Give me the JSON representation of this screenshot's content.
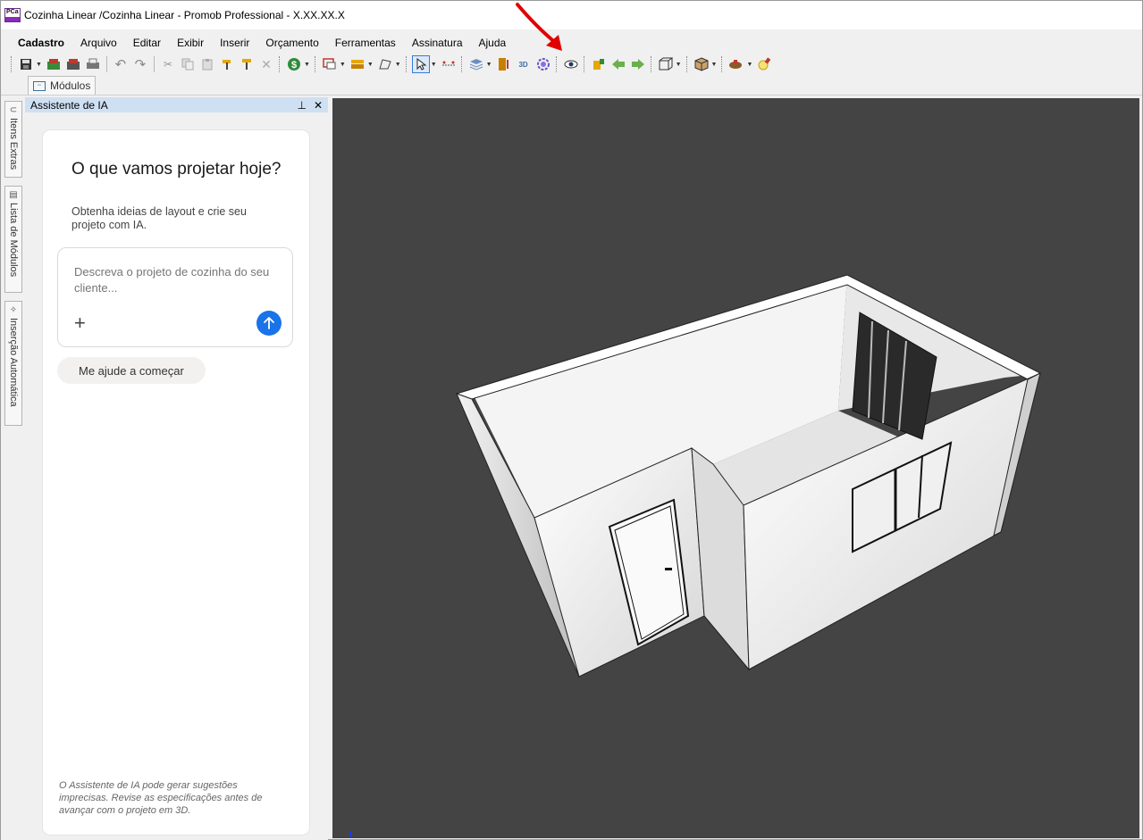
{
  "window": {
    "title": "Cozinha Linear /Cozinha Linear - Promob  Professional -  X.XX.XX.X",
    "logo_text": "PCa"
  },
  "menu": {
    "items": [
      "Cadastro",
      "Arquivo",
      "Editar",
      "Exibir",
      "Inserir",
      "Orçamento",
      "Ferramentas",
      "Assinatura",
      "Ajuda"
    ]
  },
  "toolbar": {
    "icons": [
      "save-icon",
      "undo-icon",
      "redo-icon",
      "cut-icon",
      "copy-icon",
      "paste-icon",
      "price-icon",
      "select-icon",
      "ai-assistant-icon",
      "eye-icon",
      "view3d-icon",
      "box-icon",
      "light-icon"
    ],
    "text_3d": "3D"
  },
  "modules_tab": {
    "label": "Módulos"
  },
  "side_tabs": [
    "Itens Extras",
    "Lista de Módulos",
    "Inserção Automática"
  ],
  "panel": {
    "title": "Assistente de IA",
    "heading": "O que vamos projetar hoje?",
    "subheading": "Obtenha ideias de layout e crie seu projeto com IA.",
    "input_placeholder": "Descreva o projeto de cozinha do seu cliente...",
    "plus_label": "+",
    "help_chip": "Me ajude a começar",
    "disclaimer": "O Assistente de IA pode gerar sugestões imprecisas. Revise as especificações antes de avançar com o projeto em 3D."
  },
  "colors": {
    "accent_blue": "#1a73e8",
    "viewport_bg": "#444444",
    "panel_header": "#cfe0f3",
    "annotation_red": "#e00000"
  }
}
